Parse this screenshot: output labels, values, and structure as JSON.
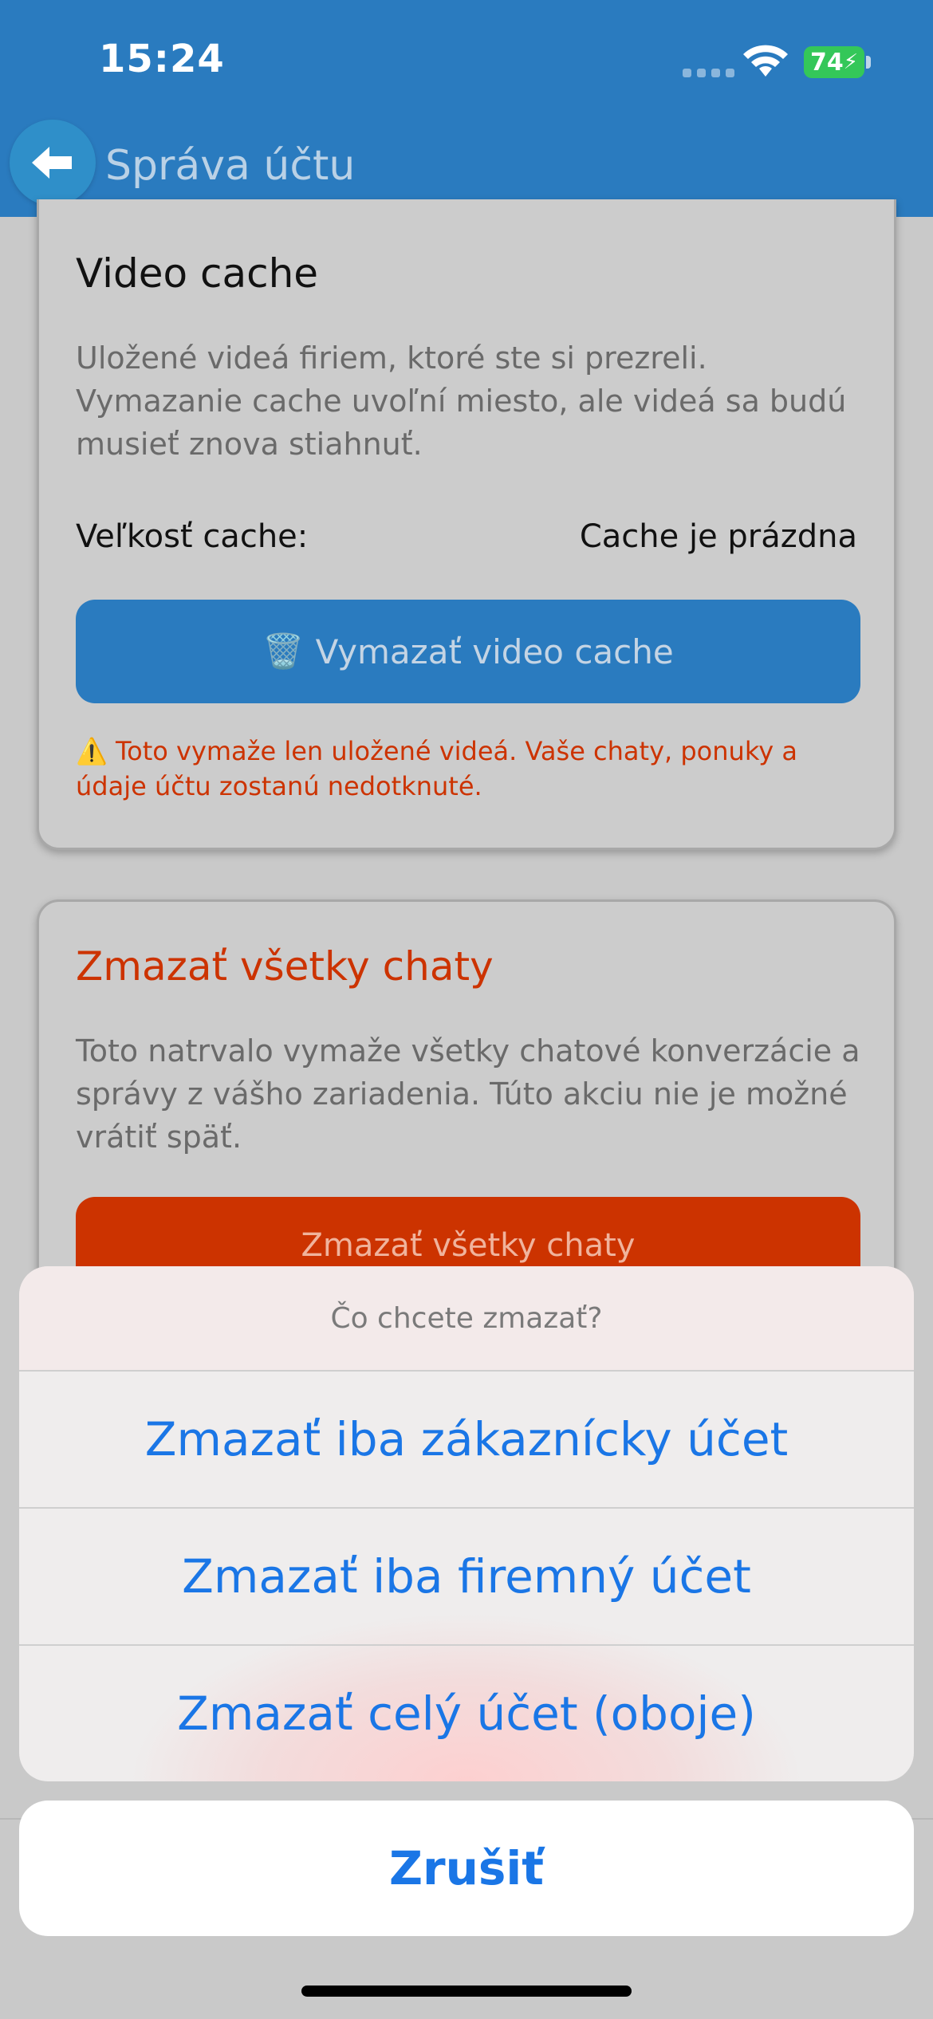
{
  "status_bar": {
    "time": "15:24",
    "battery": "74",
    "icons": [
      "cellular-signal-icon",
      "wifi-icon",
      "battery-charging-icon"
    ]
  },
  "header": {
    "back_icon": "arrow-left-icon",
    "title": "Správa účtu"
  },
  "video_cache": {
    "title": "Video cache",
    "description": "Uložené videá firiem, ktoré ste si prezreli. Vymazanie cache uvoľní miesto, ale videá sa budú musieť znova stiahnuť.",
    "size_label": "Veľkosť cache:",
    "size_value": "Cache je prázdna",
    "button_icon": "🗑️",
    "button_label": "Vymazať video cache",
    "warning_icon": "⚠️",
    "warning_text": "Toto vymaže len uložené videá. Vaše chaty, ponuky a údaje účtu zostanú nedotknuté."
  },
  "delete_chats": {
    "title": "Zmazať všetky chaty",
    "description": "Toto natrvalo vymaže všetky chatové konverzácie a správy z vášho zariadenia. Túto akciu nie je možné vrátiť späť.",
    "button_label": "Zmazať všetky chaty"
  },
  "action_sheet": {
    "title": "Čo chcete zmazať?",
    "options": [
      {
        "label": "Zmazať iba zákaznícky účet"
      },
      {
        "label": "Zmazať iba firemný účet"
      },
      {
        "label": "Zmazať celý účet (oboje)"
      }
    ],
    "cancel_label": "Zrušiť"
  },
  "colors": {
    "header_blue": "#2a7bbf",
    "danger_red": "#cc3300",
    "ios_link_blue": "#1a76e6",
    "battery_green": "#34c759"
  }
}
